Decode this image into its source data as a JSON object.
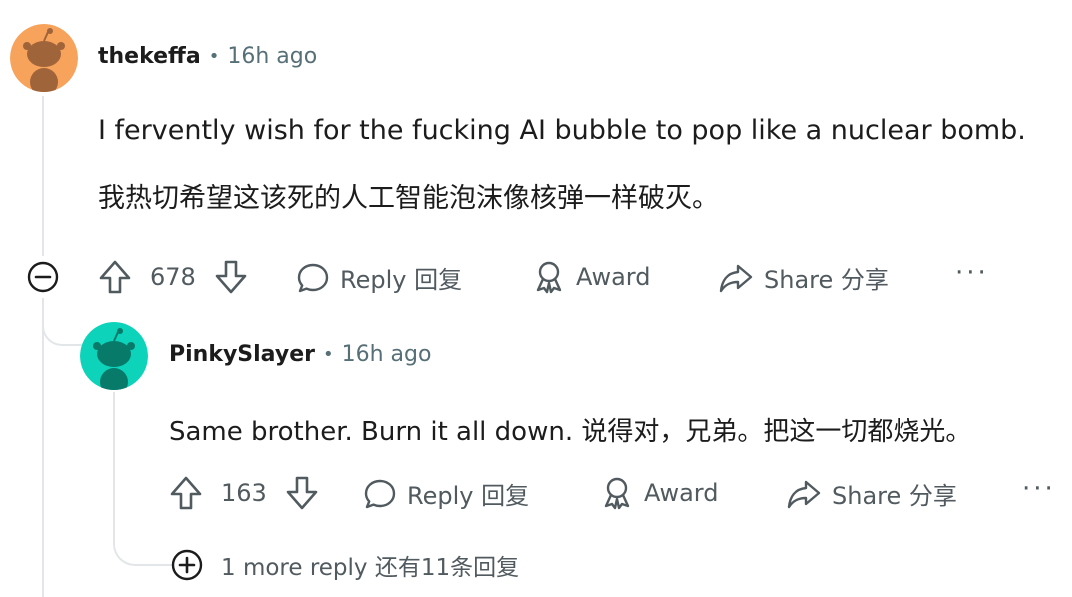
{
  "comment": {
    "author": "thekeffa",
    "time": "16h ago",
    "text_en": "I fervently wish for the fucking AI bubble to pop like a nuclear bomb.",
    "text_zh": "我热切希望这该死的人工智能泡沫像核弹一样破灭。",
    "votes": "678",
    "reply_label": "Reply 回复",
    "award_label": "Award",
    "share_label": "Share 分享",
    "avatar_color": "#f7a35c"
  },
  "reply": {
    "author": "PinkySlayer",
    "time": "16h ago",
    "text": "Same brother. Burn it all down.  说得对，兄弟。把这一切都烧光。",
    "votes": "163",
    "reply_label": "Reply 回复",
    "award_label": "Award",
    "share_label": "Share 分享",
    "avatar_color": "#0dd3bb"
  },
  "more_replies_label": "1 more reply 还有11条回复"
}
